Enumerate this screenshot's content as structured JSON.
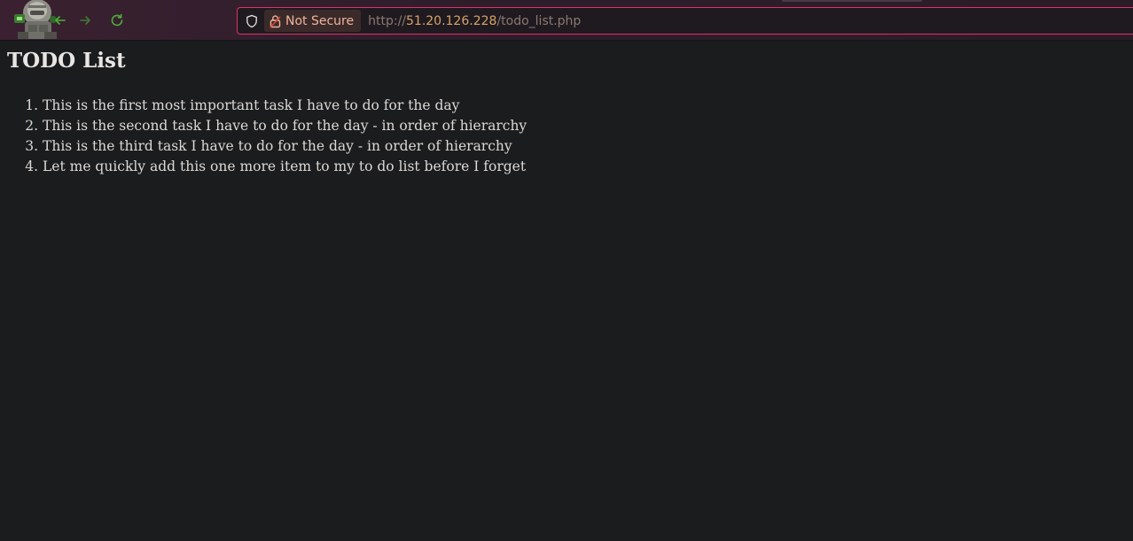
{
  "browser": {
    "security_label": "Not Secure",
    "url_scheme": "http://",
    "url_host": "51.20.126.228",
    "url_path": "/todo_list.php",
    "accent_color": "#e0306a"
  },
  "page": {
    "heading": "TODO List",
    "todos": [
      "This is the first most important task I have to do for the day",
      "This is the second task I have to do for the day - in order of hierarchy",
      "This is the third task I have to do for the day - in order of hierarchy",
      "Let me quickly add this one more item to my to do list before I forget"
    ]
  },
  "icons": {
    "avatar": "avatar-icon",
    "back": "back-arrow-icon",
    "forward": "forward-arrow-icon",
    "reload": "reload-icon",
    "shield": "shield-icon",
    "lock": "lock-icon"
  }
}
